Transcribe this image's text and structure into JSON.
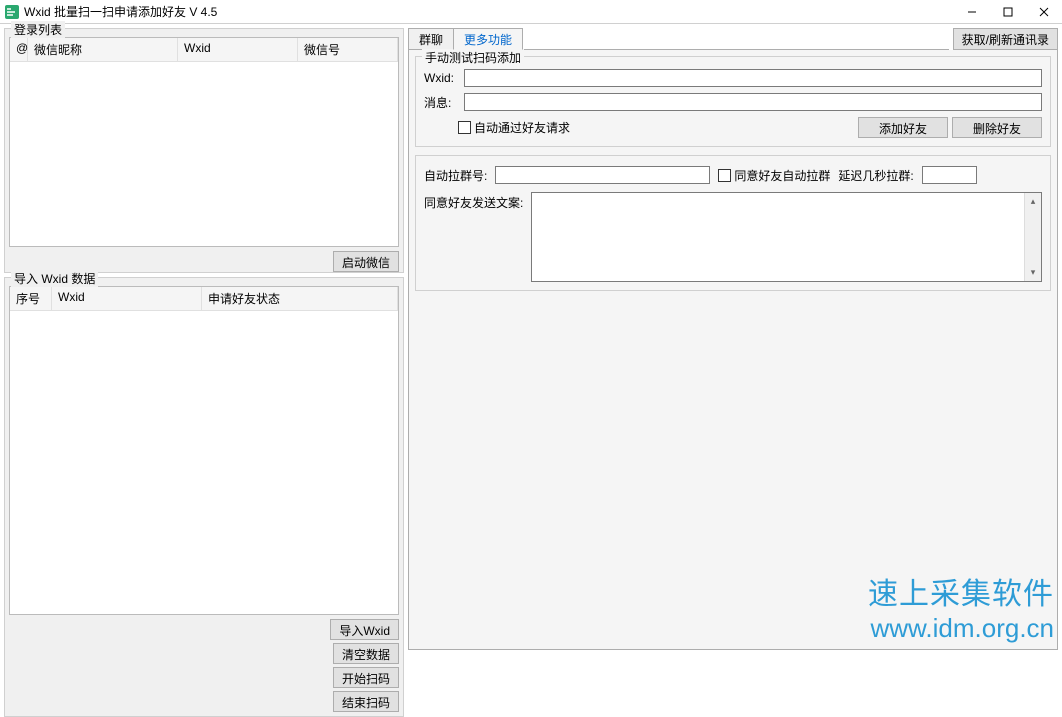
{
  "window": {
    "title": "Wxid 批量扫一扫申请添加好友 V 4.5"
  },
  "left": {
    "login_list_label": "登录列表",
    "login_columns": {
      "at": "@",
      "nick": "微信昵称",
      "wxid": "Wxid",
      "wxhao": "微信号"
    },
    "btn_launch": "启动微信",
    "import_label": "导入 Wxid 数据",
    "import_columns": {
      "seq": "序号",
      "wxid": "Wxid",
      "status": "申请好友状态"
    },
    "btn_import": "导入Wxid",
    "btn_clear": "清空数据",
    "btn_start": "开始扫码",
    "btn_end": "结束扫码"
  },
  "right": {
    "tab1": "群聊",
    "tab2": "更多功能",
    "btn_refresh": "获取/刷新通讯录",
    "manual_group_label": "手动测试扫码添加",
    "wxid_label": "Wxid:",
    "msg_label": "消息:",
    "auto_pass_label": "自动通过好友请求",
    "btn_add": "添加好友",
    "btn_delete": "删除好友",
    "auto_group_label": "自动拉群号:",
    "agree_auto_label": "同意好友自动拉群",
    "delay_label": "延迟几秒拉群:",
    "agree_send_label": "同意好友发送文案:"
  },
  "watermark": {
    "line1": "速上采集软件",
    "line2": "www.idm.org.cn"
  }
}
